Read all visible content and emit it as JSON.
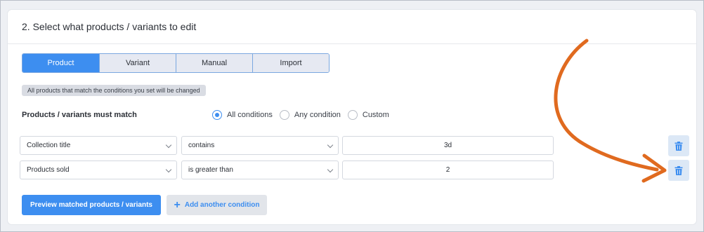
{
  "section": {
    "title": "2. Select what products / variants to edit"
  },
  "tabs": [
    {
      "label": "Product",
      "active": true
    },
    {
      "label": "Variant",
      "active": false
    },
    {
      "label": "Manual",
      "active": false
    },
    {
      "label": "Import",
      "active": false
    }
  ],
  "info": "All products that match the conditions you set will be changed",
  "match": {
    "label": "Products / variants must match",
    "options": [
      {
        "label": "All conditions",
        "selected": true
      },
      {
        "label": "Any condition",
        "selected": false
      },
      {
        "label": "Custom",
        "selected": false
      }
    ]
  },
  "conditions": [
    {
      "field": "Collection title",
      "operator": "contains",
      "value": "3d"
    },
    {
      "field": "Products sold",
      "operator": "is greater than",
      "value": "2"
    }
  ],
  "actions": {
    "preview_label": "Preview matched products / variants",
    "add_label": "Add another condition"
  },
  "colors": {
    "accent": "#3d8ef0",
    "arrow": "#e06a1f",
    "trash": "#3d8ef0"
  }
}
